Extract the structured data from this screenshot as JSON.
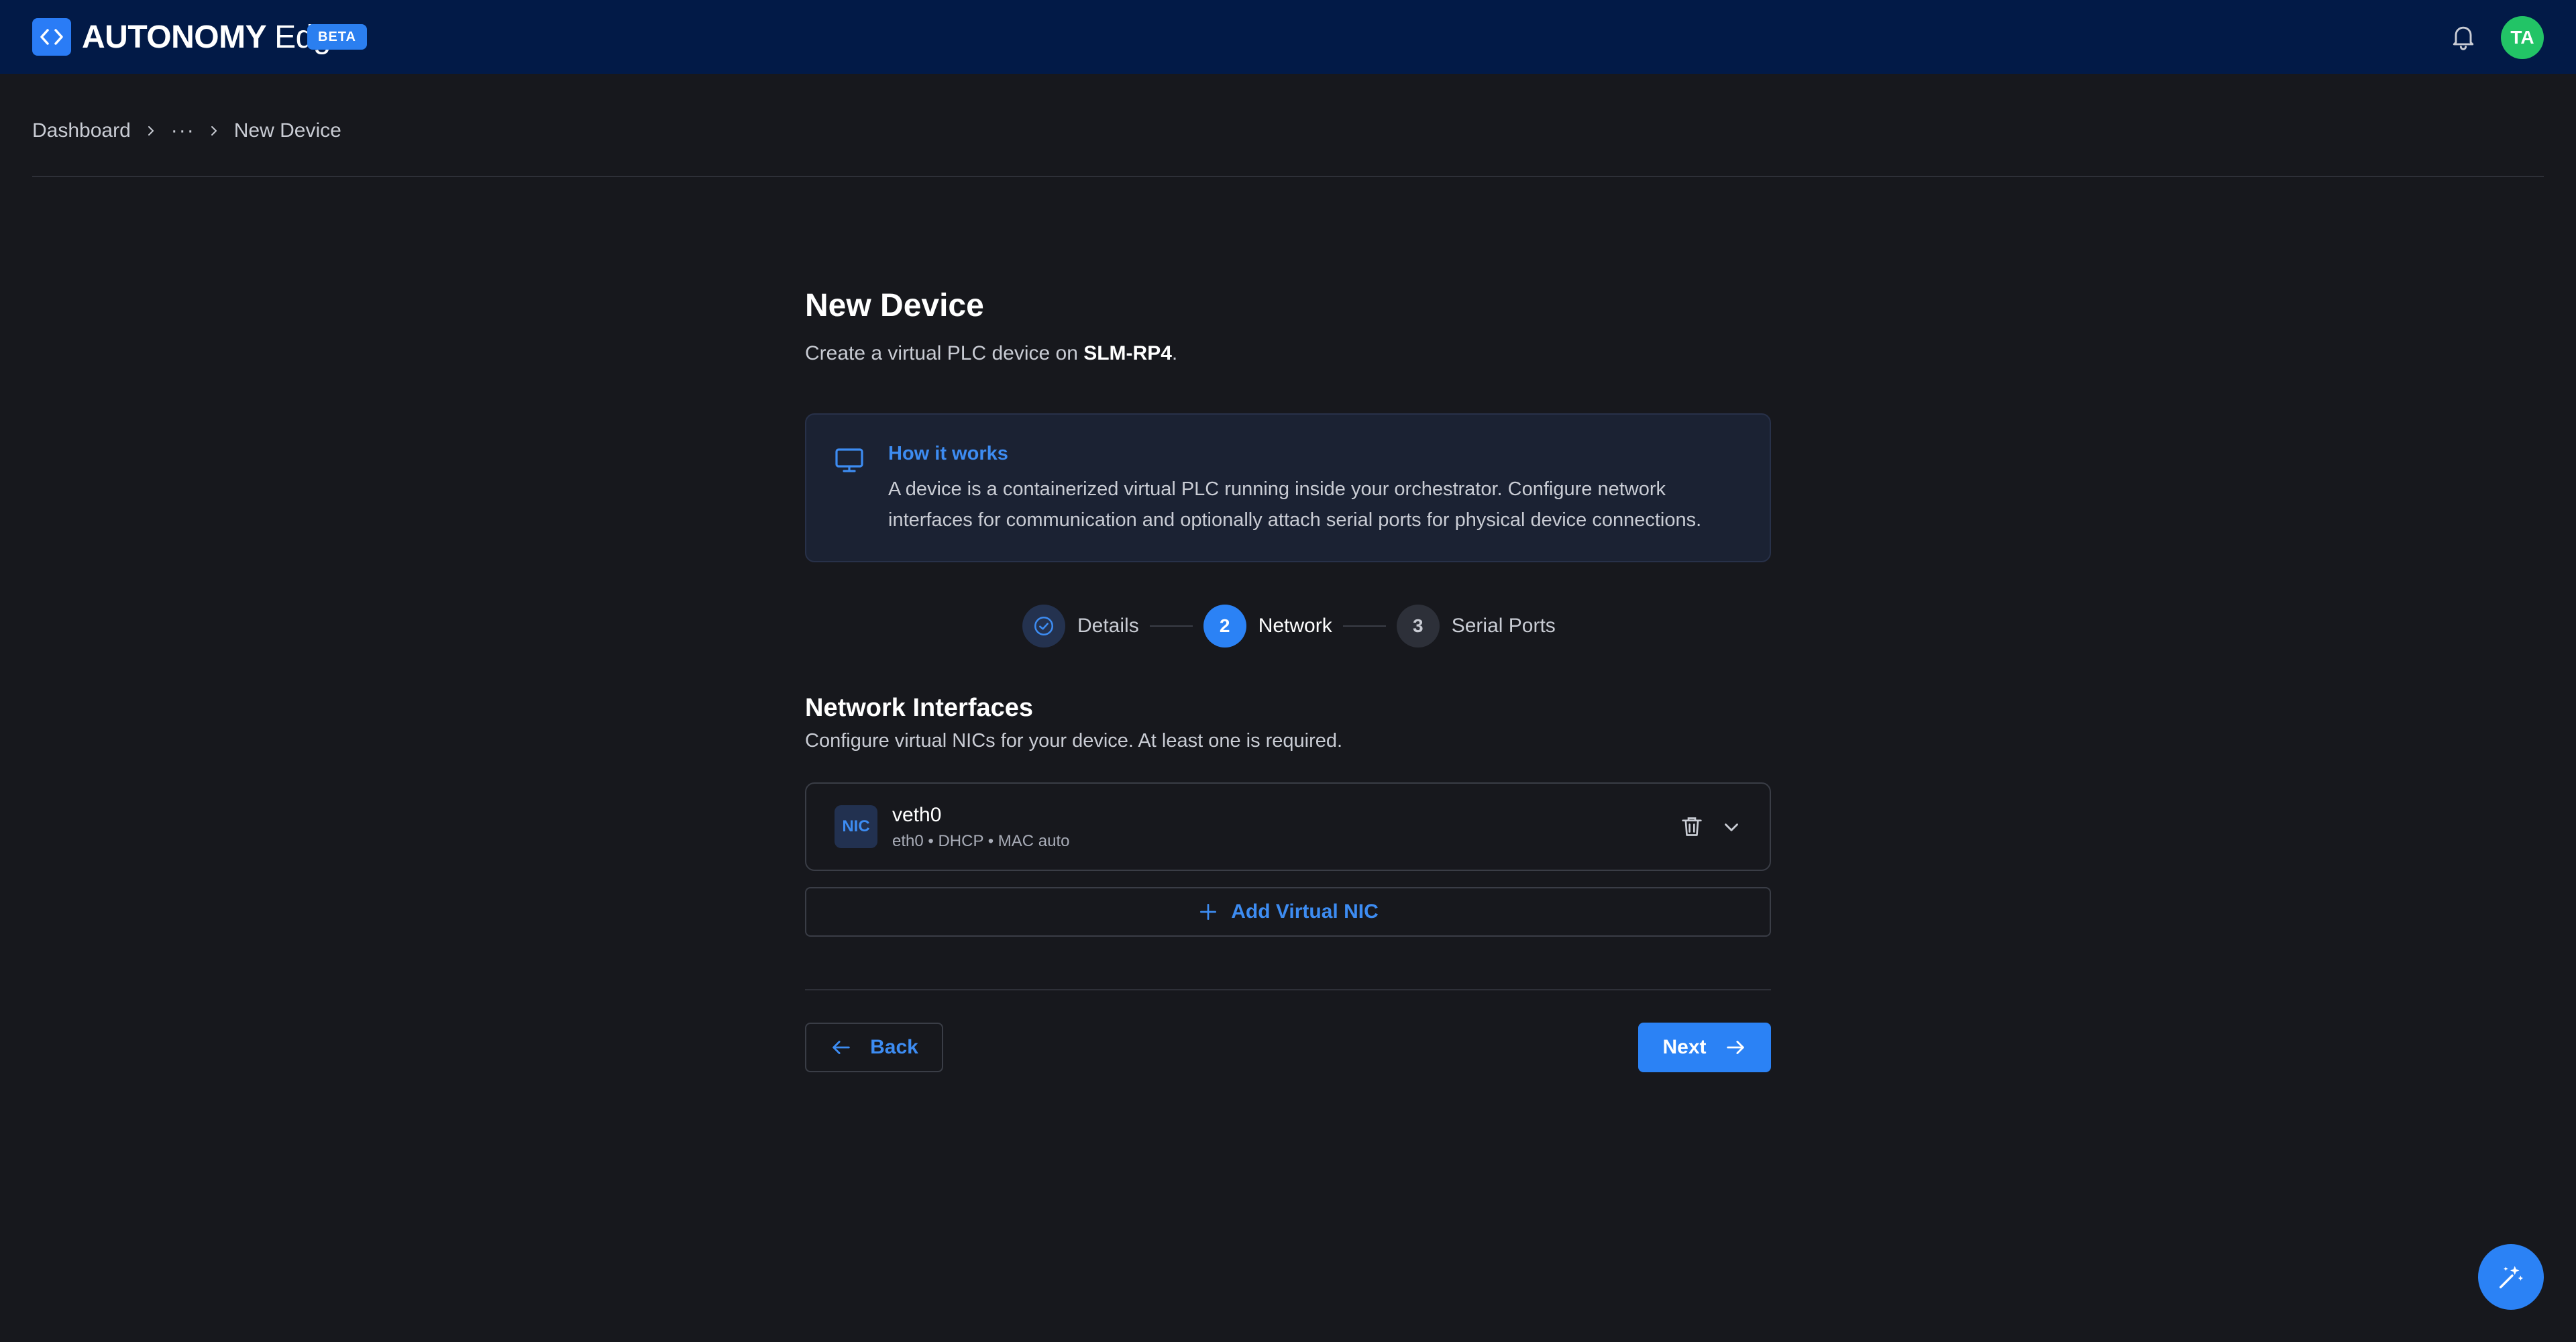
{
  "header": {
    "brand_bold": "AUTONOMY",
    "brand_light": "Edge",
    "badge": "BETA",
    "avatar_initials": "TA",
    "icons": {
      "logo": "code-brackets-icon",
      "notifications": "bell-icon"
    }
  },
  "breadcrumb": {
    "items": [
      "Dashboard",
      "New Device"
    ],
    "overflow": "···"
  },
  "page": {
    "title": "New Device",
    "subtitle_prefix": "Create a virtual PLC device on ",
    "subtitle_device": "SLM-RP4",
    "subtitle_suffix": "."
  },
  "info": {
    "title": "How it works",
    "text": "A device is a containerized virtual PLC running inside your orchestrator. Configure network interfaces for communication and optionally attach serial ports for physical device connections.",
    "icon": "monitor-icon"
  },
  "stepper": {
    "steps": [
      {
        "number": "1",
        "label": "Details",
        "state": "done"
      },
      {
        "number": "2",
        "label": "Network",
        "state": "active"
      },
      {
        "number": "3",
        "label": "Serial Ports",
        "state": "pending"
      }
    ]
  },
  "network": {
    "title": "Network Interfaces",
    "subtitle": "Configure virtual NICs for your device. At least one is required.",
    "nics": [
      {
        "badge": "NIC",
        "name": "veth0",
        "meta": "eth0 • DHCP • MAC auto"
      }
    ],
    "add_label": "Add Virtual NIC"
  },
  "footer": {
    "back_label": "Back",
    "next_label": "Next"
  },
  "colors": {
    "topbar": "#021a47",
    "background": "#17181d",
    "accent": "#2b82f5",
    "avatar": "#22c466"
  }
}
